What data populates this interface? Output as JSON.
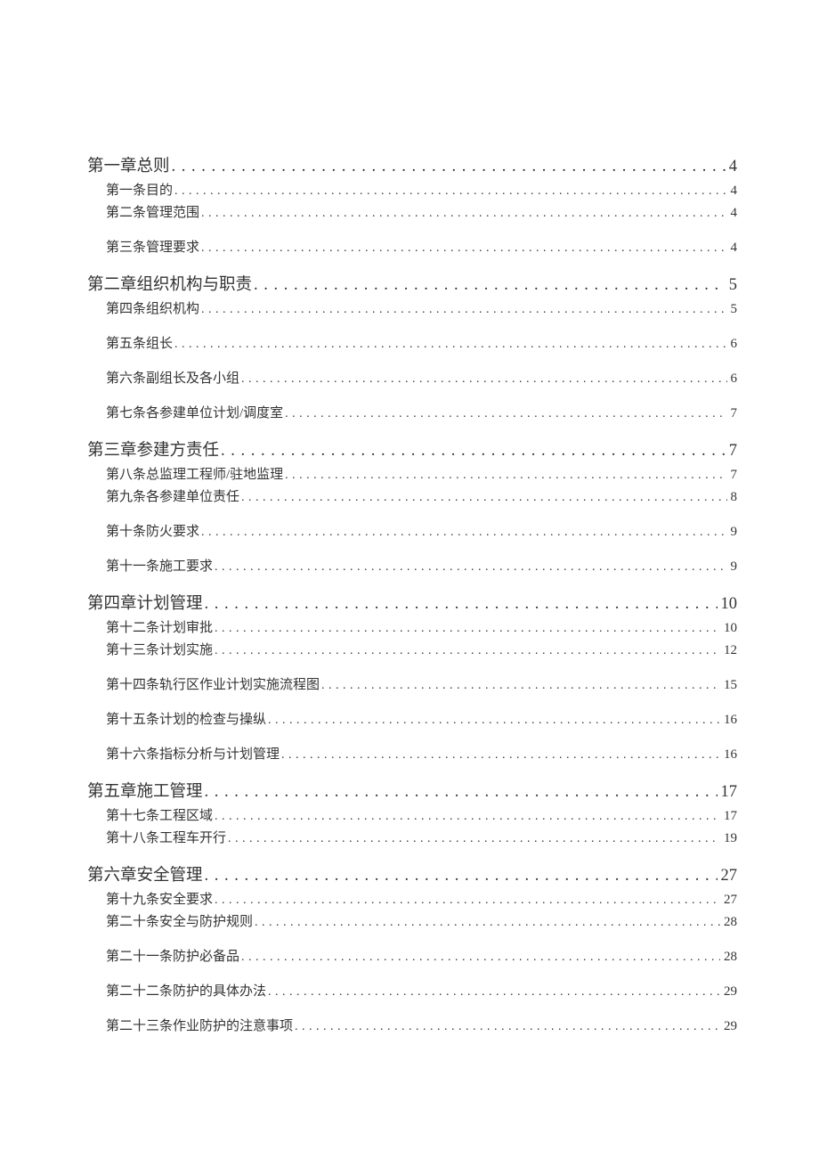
{
  "toc": [
    {
      "type": "chapter",
      "label": "第一章总则",
      "page": "4"
    },
    {
      "type": "item",
      "label": "第一条目的",
      "page": "4",
      "tight": true
    },
    {
      "type": "item",
      "label": "第二条管理范围",
      "page": "4"
    },
    {
      "type": "item",
      "label": "第三条管理要求",
      "page": "4"
    },
    {
      "type": "chapter",
      "label": "第二章组织机构与职责",
      "page": "5",
      "gap": true
    },
    {
      "type": "item",
      "label": "第四条组织机构",
      "page": "5"
    },
    {
      "type": "item",
      "label": "第五条组长",
      "page": "6"
    },
    {
      "type": "item",
      "label": "第六条副组长及各小组",
      "page": "6"
    },
    {
      "type": "item",
      "label": "第七条各参建单位计划/调度室",
      "page": "7"
    },
    {
      "type": "chapter",
      "label": "第三章参建方责任",
      "page": "7",
      "gap": true
    },
    {
      "type": "item",
      "label": "第八条总监理工程师/驻地监理",
      "page": "7",
      "tight": true
    },
    {
      "type": "item",
      "label": "第九条各参建单位责任",
      "page": "8"
    },
    {
      "type": "item",
      "label": "第十条防火要求",
      "page": "9"
    },
    {
      "type": "item",
      "label": "第十一条施工要求",
      "page": "9"
    },
    {
      "type": "chapter",
      "label": "第四章计划管理",
      "page": "10",
      "gap": true
    },
    {
      "type": "item",
      "label": "第十二条计划审批",
      "page": "10",
      "tight": true
    },
    {
      "type": "item",
      "label": "第十三条计划实施",
      "page": "12"
    },
    {
      "type": "item",
      "label": "第十四条轨行区作业计划实施流程图",
      "page": "15"
    },
    {
      "type": "item",
      "label": "第十五条计划的检查与操纵",
      "page": "16"
    },
    {
      "type": "item",
      "label": "第十六条指标分析与计划管理",
      "page": "16"
    },
    {
      "type": "chapter",
      "label": "第五章施工管理",
      "page": "17",
      "gap": true
    },
    {
      "type": "item",
      "label": "第十七条工程区域",
      "page": "17",
      "tight": true
    },
    {
      "type": "item",
      "label": "第十八条工程车开行",
      "page": "19"
    },
    {
      "type": "chapter",
      "label": "第六章安全管理",
      "page": "27",
      "gap": true
    },
    {
      "type": "item",
      "label": "第十九条安全要求",
      "page": "27",
      "tight": true
    },
    {
      "type": "item",
      "label": "第二十条安全与防护规则",
      "page": "28"
    },
    {
      "type": "item",
      "label": "第二十一条防护必备品",
      "page": "28"
    },
    {
      "type": "item",
      "label": "第二十二条防护的具体办法",
      "page": "29"
    },
    {
      "type": "item",
      "label": "第二十三条作业防护的注意事项",
      "page": "29"
    }
  ]
}
